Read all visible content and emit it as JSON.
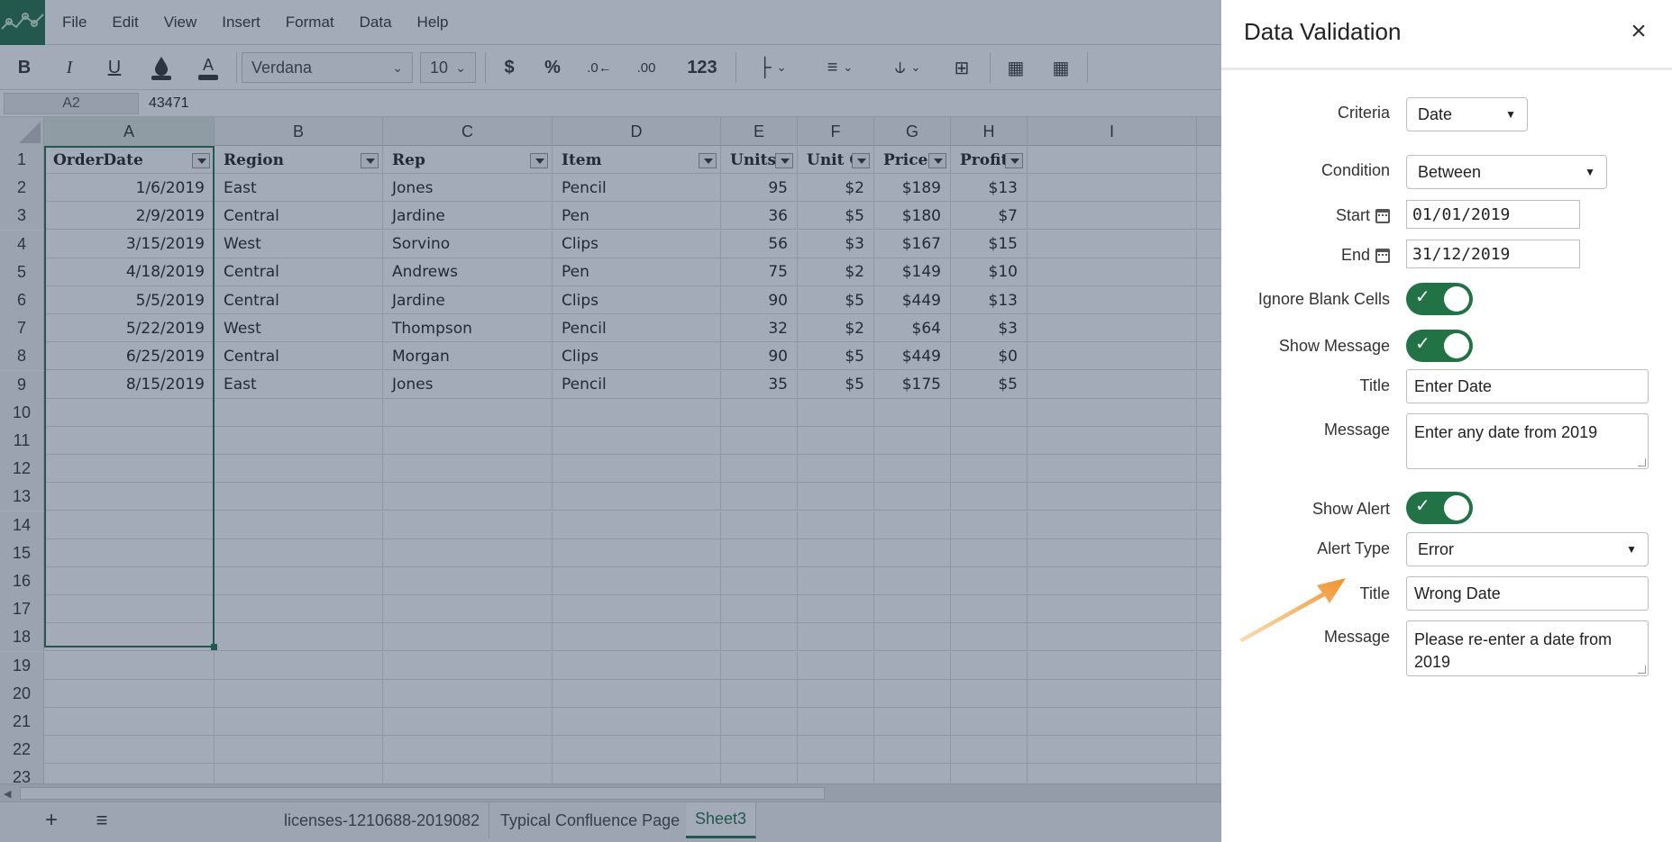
{
  "menu": [
    "File",
    "Edit",
    "View",
    "Insert",
    "Format",
    "Data",
    "Help"
  ],
  "toolbar": {
    "font": "Verdana",
    "size": "10",
    "currency": "$",
    "percent": "%",
    "number_format": "123"
  },
  "formula_bar": {
    "cell_ref": "A2",
    "value": "43471"
  },
  "columns": [
    "A",
    "B",
    "C",
    "D",
    "E",
    "F",
    "G",
    "H",
    "I"
  ],
  "headers": [
    "OrderDate",
    "Region",
    "Rep",
    "Item",
    "Units",
    "Unit C",
    "Price",
    "Profits"
  ],
  "rows": [
    [
      "1/6/2019",
      "East",
      "Jones",
      "Pencil",
      "95",
      "$2",
      "$189",
      "$13"
    ],
    [
      "2/9/2019",
      "Central",
      "Jardine",
      "Pen",
      "36",
      "$5",
      "$180",
      "$7"
    ],
    [
      "3/15/2019",
      "West",
      "Sorvino",
      "Clips",
      "56",
      "$3",
      "$167",
      "$15"
    ],
    [
      "4/18/2019",
      "Central",
      "Andrews",
      "Pen",
      "75",
      "$2",
      "$149",
      "$10"
    ],
    [
      "5/5/2019",
      "Central",
      "Jardine",
      "Clips",
      "90",
      "$5",
      "$449",
      "$13"
    ],
    [
      "5/22/2019",
      "West",
      "Thompson",
      "Pencil",
      "32",
      "$2",
      "$64",
      "$3"
    ],
    [
      "6/25/2019",
      "Central",
      "Morgan",
      "Clips",
      "90",
      "$5",
      "$449",
      "$0"
    ],
    [
      "8/15/2019",
      "East",
      "Jones",
      "Pencil",
      "35",
      "$5",
      "$175",
      "$5"
    ]
  ],
  "row_numbers": [
    "1",
    "2",
    "3",
    "4",
    "5",
    "6",
    "7",
    "8",
    "9",
    "10",
    "11",
    "12",
    "13",
    "14",
    "15",
    "16",
    "17",
    "18",
    "19",
    "20",
    "21",
    "22",
    "23"
  ],
  "sheets": [
    "licenses-1210688-2019082",
    "Typical Confluence Page",
    "Sheet3"
  ],
  "active_sheet": "Sheet3",
  "dialog": {
    "title": "Data Validation",
    "criteria_label": "Criteria",
    "criteria_value": "Date",
    "condition_label": "Condition",
    "condition_value": "Between",
    "start_label": "Start",
    "start_value": "01/01/2019",
    "end_label": "End",
    "end_value": "31/12/2019",
    "ignore_blank_label": "Ignore Blank Cells",
    "ignore_blank_on": true,
    "show_message_label": "Show Message",
    "show_message_on": true,
    "msg_title_label": "Title",
    "msg_title_value": "Enter Date",
    "msg_message_label": "Message",
    "msg_message_value": "Enter any date from 2019",
    "show_alert_label": "Show Alert",
    "show_alert_on": true,
    "alert_type_label": "Alert Type",
    "alert_type_value": "Error",
    "alert_title_label": "Title",
    "alert_title_value": "Wrong Date",
    "alert_message_label": "Message",
    "alert_message_value": "Please re-enter a date from 2019"
  },
  "colors": {
    "accent": "#217346",
    "overlay": "#233755",
    "arrow": "#f0922b"
  }
}
